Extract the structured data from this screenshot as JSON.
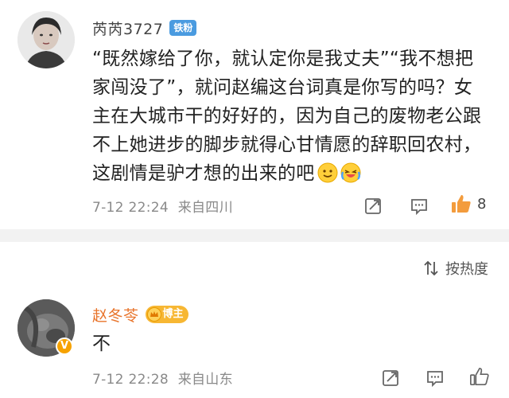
{
  "comments": [
    {
      "username": "芮芮3727",
      "badge": "铁粉",
      "text": "“既然嫁给了你，就认定你是我丈夫”“我不想把家闯没了”，就问赵编这台词真是你写的吗？女主在大城市干的好好的，因为自己的废物老公跟不上她进步的脚步就得心甘情愿的辞职回农村，这剧情是驴才想的出来的吧",
      "emojis": [
        "smile-emoji",
        "crying-laugh-emoji"
      ],
      "timestamp": "7-12 22:24",
      "location": "来自四川",
      "like_count": "8"
    },
    {
      "username": "赵冬苓",
      "badge": "博主",
      "text": "不",
      "timestamp": "7-12 22:28",
      "location": "来自山东"
    }
  ],
  "sort": {
    "label": "按热度"
  },
  "colors": {
    "fan_badge": "#4a9be0",
    "blogger_name": "#e8742b",
    "blogger_badge": "#f7b733",
    "like_active": "#f39c3d",
    "divider": "#f2f2f2"
  },
  "icons": [
    "share-icon",
    "comment-icon",
    "like-icon",
    "sort-icon",
    "verified-icon",
    "crown-icon"
  ]
}
